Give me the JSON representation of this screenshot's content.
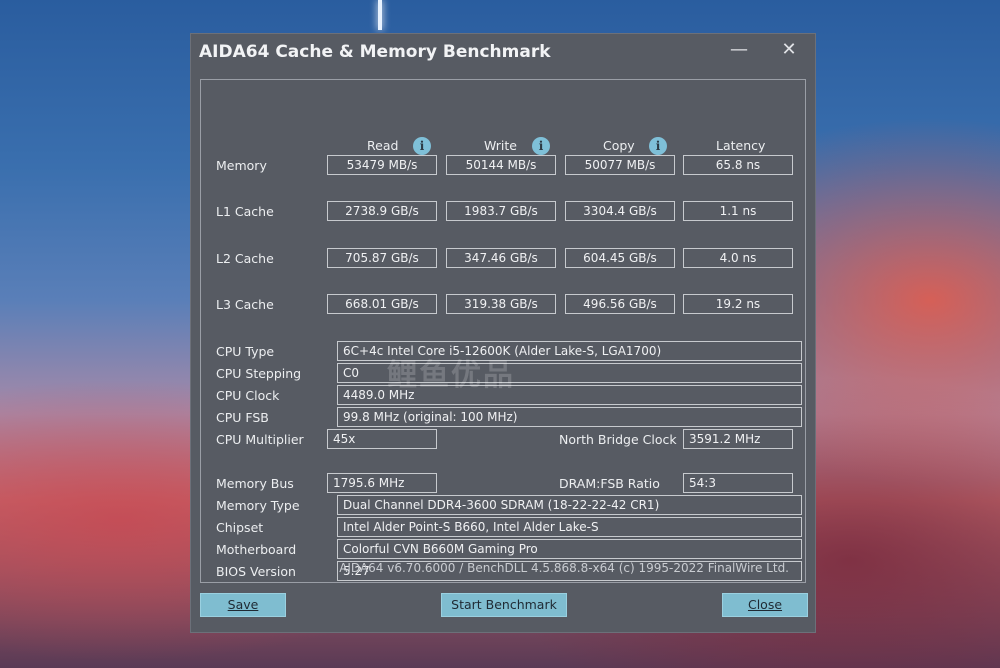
{
  "window": {
    "title": "AIDA64 Cache & Memory Benchmark",
    "minimize": "—",
    "close": "✕"
  },
  "columns": {
    "read": "Read",
    "write": "Write",
    "copy": "Copy",
    "latency": "Latency",
    "info": "i"
  },
  "rows": [
    {
      "label": "Memory",
      "read": "53479 MB/s",
      "write": "50144 MB/s",
      "copy": "50077 MB/s",
      "latency": "65.8 ns"
    },
    {
      "label": "L1 Cache",
      "read": "2738.9 GB/s",
      "write": "1983.7 GB/s",
      "copy": "3304.4 GB/s",
      "latency": "1.1 ns"
    },
    {
      "label": "L2 Cache",
      "read": "705.87 GB/s",
      "write": "347.46 GB/s",
      "copy": "604.45 GB/s",
      "latency": "4.0 ns"
    },
    {
      "label": "L3 Cache",
      "read": "668.01 GB/s",
      "write": "319.38 GB/s",
      "copy": "496.56 GB/s",
      "latency": "19.2 ns"
    }
  ],
  "cpu": {
    "type_label": "CPU Type",
    "type": "6C+4c Intel Core i5-12600K  (Alder Lake-S, LGA1700)",
    "stepping_label": "CPU Stepping",
    "stepping": "C0",
    "clock_label": "CPU Clock",
    "clock": "4489.0 MHz",
    "fsb_label": "CPU FSB",
    "fsb": "99.8 MHz  (original: 100 MHz)",
    "multiplier_label": "CPU Multiplier",
    "multiplier": "45x",
    "nb_label": "North Bridge Clock",
    "nb": "3591.2 MHz"
  },
  "memory": {
    "bus_label": "Memory Bus",
    "bus": "1795.6 MHz",
    "ratio_label": "DRAM:FSB Ratio",
    "ratio": "54:3",
    "type_label": "Memory Type",
    "type": "Dual Channel DDR4-3600 SDRAM  (18-22-22-42 CR1)",
    "chipset_label": "Chipset",
    "chipset": "Intel Alder Point-S B660, Intel Alder Lake-S",
    "motherboard_label": "Motherboard",
    "motherboard": "Colorful CVN B660M Gaming Pro",
    "bios_label": "BIOS Version",
    "bios": "5.27"
  },
  "footer": "AIDA64 v6.70.6000 / BenchDLL 4.5.868.8-x64  (c) 1995-2022 FinalWire Ltd.",
  "buttons": {
    "save": "Save",
    "start": "Start Benchmark",
    "close": "Close"
  },
  "watermark": "鲤鱼优品"
}
